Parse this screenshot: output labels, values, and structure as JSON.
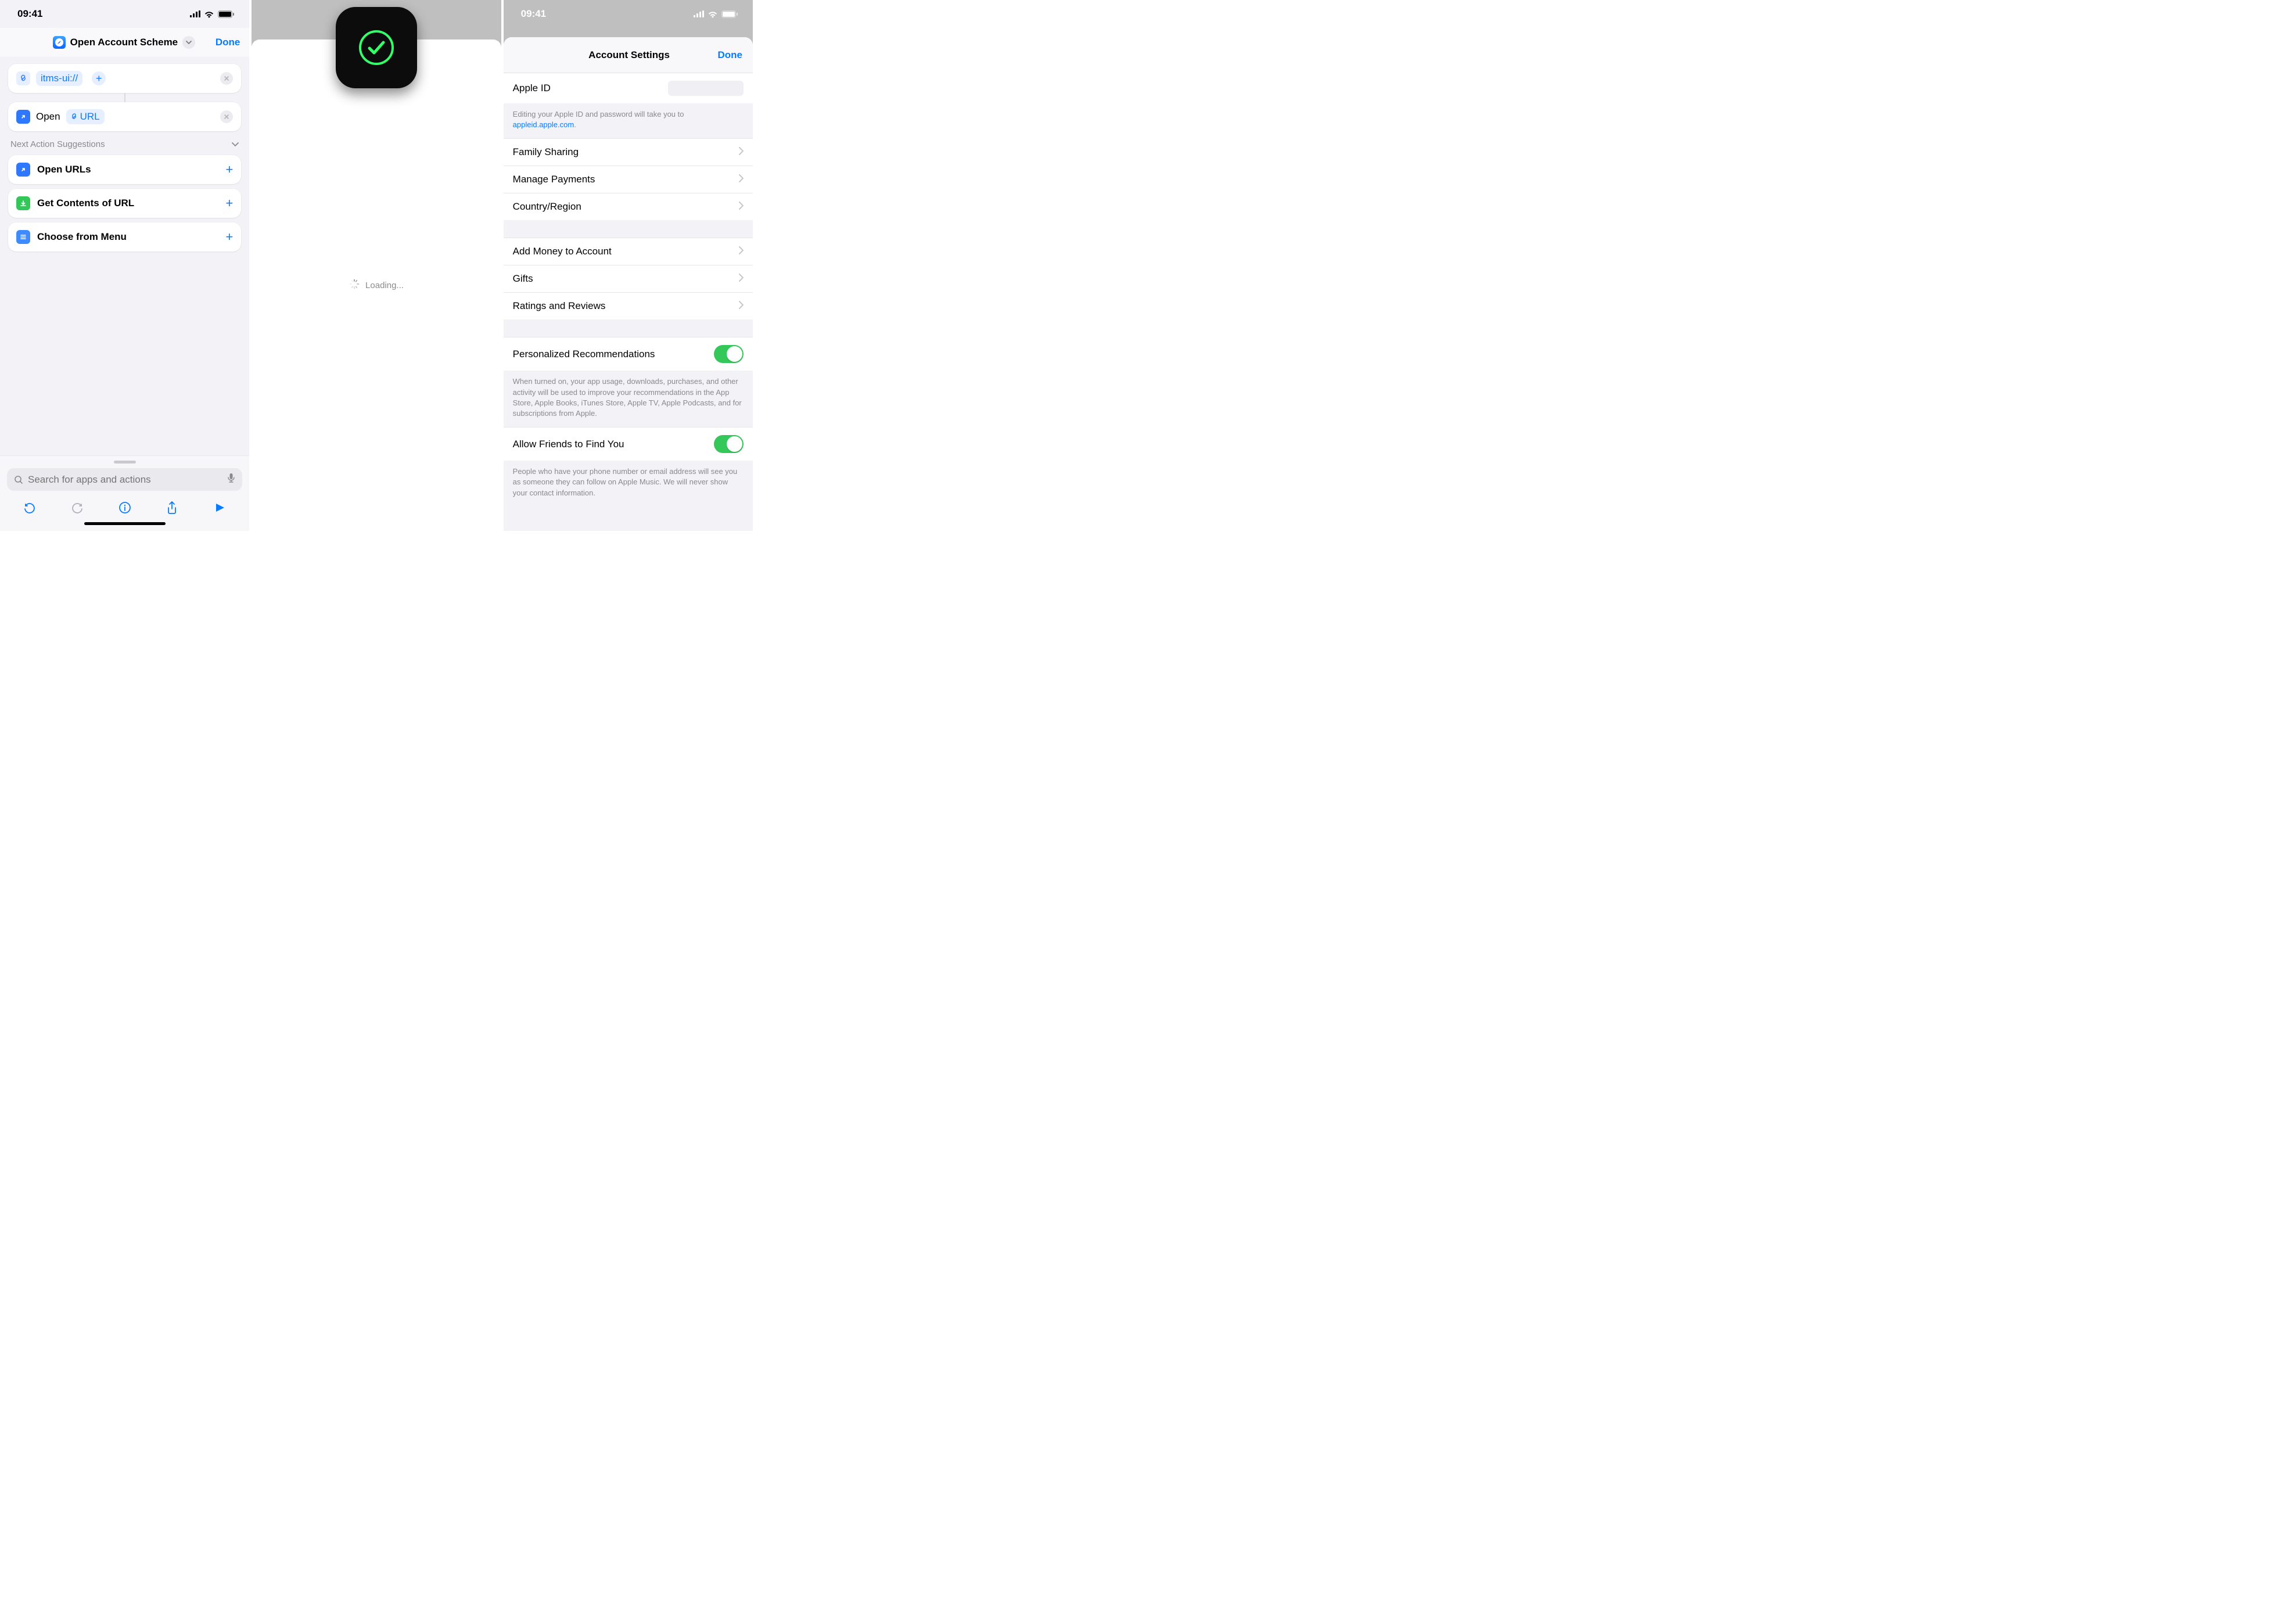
{
  "status": {
    "time": "09:41"
  },
  "screen1": {
    "header": {
      "title": "Open Account Scheme",
      "done": "Done"
    },
    "urlCard": {
      "value": "itms-ui://"
    },
    "openCard": {
      "label": "Open",
      "param": "URL"
    },
    "suggestions": {
      "heading": "Next Action Suggestions",
      "items": [
        {
          "name": "Open URLs",
          "icon": "open"
        },
        {
          "name": "Get Contents of URL",
          "icon": "green"
        },
        {
          "name": "Choose from Menu",
          "icon": "menu"
        }
      ]
    },
    "search": {
      "placeholder": "Search for apps and actions"
    }
  },
  "screen2": {
    "loading": "Loading..."
  },
  "screen3": {
    "nav": {
      "title": "Account Settings",
      "done": "Done"
    },
    "appleId": {
      "label": "Apple ID",
      "note_prefix": "Editing your Apple ID and password will take you to ",
      "note_link": "appleid.apple.com",
      "note_suffix": "."
    },
    "groupA": [
      "Family Sharing",
      "Manage Payments",
      "Country/Region"
    ],
    "groupB": [
      "Add Money to Account",
      "Gifts",
      "Ratings and Reviews"
    ],
    "toggle1": {
      "label": "Personalized Recommendations",
      "note": "When turned on, your app usage, downloads, purchases, and other activity will be used to improve your recommendations in the App Store, Apple Books, iTunes Store, Apple TV, Apple Podcasts, and for subscriptions from Apple."
    },
    "toggle2": {
      "label": "Allow Friends to Find You",
      "note": "People who have your phone number or email address will see you as someone they can follow on Apple Music. We will never show your contact information."
    }
  }
}
